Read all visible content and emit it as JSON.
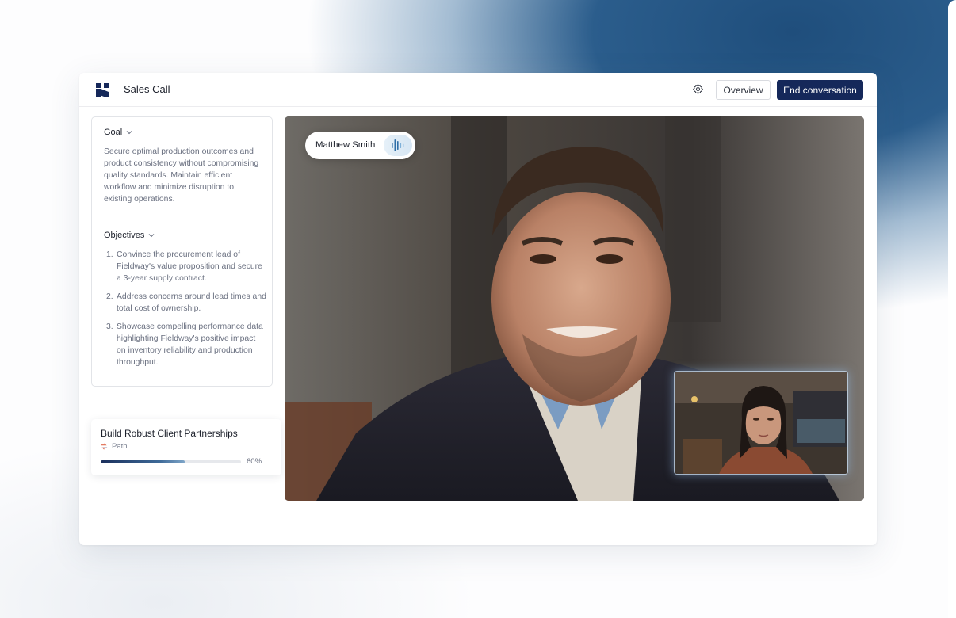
{
  "header": {
    "title": "Sales Call",
    "overview_label": "Overview",
    "end_label": "End conversation",
    "logo_icon": "brand-logo-icon",
    "settings_icon": "gear-icon"
  },
  "goal": {
    "heading": "Goal",
    "text": "Secure optimal production outcomes and product consistency without compromising quality standards. Maintain efficient workflow and minimize disruption to existing operations."
  },
  "objectives": {
    "heading": "Objectives",
    "items": [
      "Convince the procurement lead of Fieldway's value proposition and secure a 3-year supply contract.",
      "Address concerns around lead times and total cost of ownership.",
      "Showcase compelling performance data highlighting Fieldway's positive impact on inventory reliability and production throughput."
    ]
  },
  "path_card": {
    "title": "Build Robust Client Partnerships",
    "subtitle": "Path",
    "progress": 60,
    "progress_label": "60%",
    "icon": "path-icon"
  },
  "video": {
    "speaker_name": "Matthew Smith",
    "speaking_icon": "audio-wave-icon",
    "self_view": "pip-video"
  },
  "colors": {
    "primary": "#15285a",
    "backdrop": "#2b5d8c"
  }
}
